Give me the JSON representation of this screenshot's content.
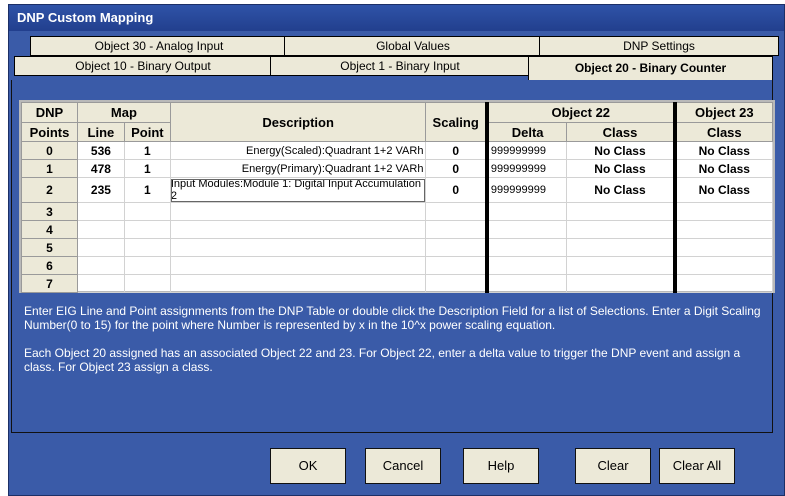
{
  "window": {
    "title": "DNP Custom Mapping"
  },
  "tabs_back": [
    "Object 30 - Analog Input",
    "Global Values",
    "DNP Settings"
  ],
  "tabs_front": [
    "Object 10 - Binary Output",
    "Object 1 - Binary Input",
    "Object 20 - Binary Counter"
  ],
  "active_tab": "Object 20 - Binary Counter",
  "table": {
    "headers": {
      "dnp": "DNP",
      "points": "Points",
      "map": "Map",
      "line": "Line",
      "point": "Point",
      "description": "Description",
      "scaling": "Scaling",
      "obj22": "Object 22",
      "delta": "Delta",
      "class": "Class",
      "obj23": "Object 23",
      "obj23class": "Class"
    },
    "rows": [
      {
        "dnp": "0",
        "line": "536",
        "point": "1",
        "description": "Energy(Scaled):Quadrant 1+2 VARh",
        "scaling": "0",
        "delta": "999999999",
        "class22": "No Class",
        "class23": "No Class"
      },
      {
        "dnp": "1",
        "line": "478",
        "point": "1",
        "description": "Energy(Primary):Quadrant 1+2 VARh",
        "scaling": "0",
        "delta": "999999999",
        "class22": "No Class",
        "class23": "No Class"
      },
      {
        "dnp": "2",
        "line": "235",
        "point": "1",
        "description": "Input Modules:Module 1: Digital Input Accumulation 2",
        "scaling": "0",
        "delta": "999999999",
        "class22": "No Class",
        "class23": "No Class"
      },
      {
        "dnp": "3",
        "line": "",
        "point": "",
        "description": "",
        "scaling": "",
        "delta": "",
        "class22": "",
        "class23": ""
      },
      {
        "dnp": "4",
        "line": "",
        "point": "",
        "description": "",
        "scaling": "",
        "delta": "",
        "class22": "",
        "class23": ""
      },
      {
        "dnp": "5",
        "line": "",
        "point": "",
        "description": "",
        "scaling": "",
        "delta": "",
        "class22": "",
        "class23": ""
      },
      {
        "dnp": "6",
        "line": "",
        "point": "",
        "description": "",
        "scaling": "",
        "delta": "",
        "class22": "",
        "class23": ""
      },
      {
        "dnp": "7",
        "line": "",
        "point": "",
        "description": "",
        "scaling": "",
        "delta": "",
        "class22": "",
        "class23": ""
      }
    ]
  },
  "instructions": [
    "Enter EIG Line and Point assignments from the DNP Table or double click the Description Field for a list of Selections.  Enter a Digit Scaling Number(0 to 15) for the point where Number is represented by x in the 10^x power scaling equation.",
    "Each Object 20 assigned has an associated Object 22 and 23.  For Object 22, enter a delta value to trigger the DNP event and assign a class.  For Object 23 assign a class."
  ],
  "buttons": {
    "ok": "OK",
    "cancel": "Cancel",
    "help": "Help",
    "clear": "Clear",
    "clear_all": "Clear All"
  }
}
